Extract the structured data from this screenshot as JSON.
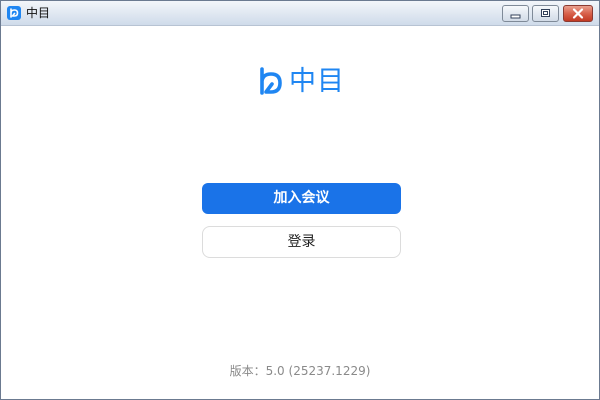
{
  "window": {
    "title": "中目"
  },
  "logo": {
    "text": "中目"
  },
  "actions": {
    "join_label": "加入会议",
    "login_label": "登录"
  },
  "footer": {
    "version_label": "版本：",
    "version_value": "5.0 (25237.1229)"
  },
  "icons": {
    "app": "zhongmu-logo-icon",
    "minimize": "minimize-icon",
    "maximize": "maximize-icon",
    "close": "close-icon"
  },
  "colors": {
    "brand": "#1f86f2",
    "primary_button": "#1a73e8",
    "close_button": "#c13a24"
  }
}
